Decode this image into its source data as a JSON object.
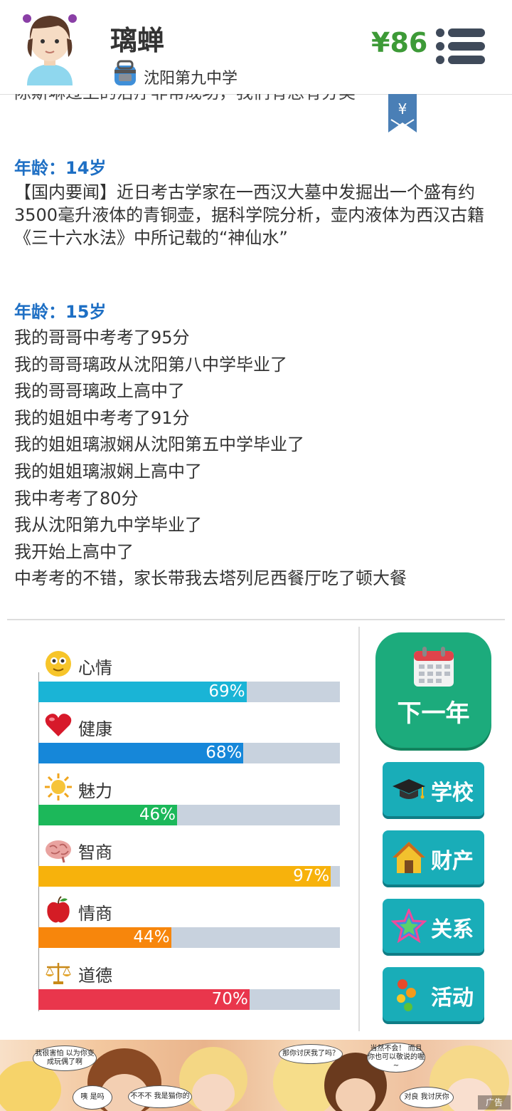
{
  "profile": {
    "name": "璃蝉",
    "school": "沈阳第九中学",
    "money": "¥86"
  },
  "log": {
    "cut_line": "陈斯琳过上的治疗非常成功，我们有总有分类",
    "bookmark_symbol": "¥",
    "entries": [
      {
        "age": "年龄：14岁",
        "lines": [
          "【国内要闻】近日考古学家在一西汉大墓中发掘出一个盛有约3500毫升液体的青铜壶，据科学院分析，壶内液体为西汉古籍《三十六水法》中所记载的“神仙水”"
        ]
      },
      {
        "age": "年龄：15岁",
        "lines": [
          "我的哥哥中考考了95分",
          "我的哥哥璃政从沈阳第八中学毕业了",
          "我的哥哥璃政上高中了",
          "我的姐姐中考考了91分",
          "我的姐姐璃淑娴从沈阳第五中学毕业了",
          "我的姐姐璃淑娴上高中了",
          "我中考考了80分",
          "我从沈阳第九中学毕业了",
          "我开始上高中了",
          "中考考的不错，家长带我去塔列尼西餐厅吃了顿大餐"
        ]
      }
    ]
  },
  "stats": [
    {
      "label": "心情",
      "value": 69,
      "pct": "69%",
      "color": "#1ab4d6",
      "icon": "smiley-icon"
    },
    {
      "label": "健康",
      "value": 68,
      "pct": "68%",
      "color": "#1687d9",
      "icon": "heart-icon"
    },
    {
      "label": "魅力",
      "value": 46,
      "pct": "46%",
      "color": "#1cb85a",
      "icon": "sun-icon"
    },
    {
      "label": "智商",
      "value": 97,
      "pct": "97%",
      "color": "#f7b20c",
      "icon": "brain-icon"
    },
    {
      "label": "情商",
      "value": 44,
      "pct": "44%",
      "color": "#f7860c",
      "icon": "apple-icon"
    },
    {
      "label": "道德",
      "value": 70,
      "pct": "70%",
      "color": "#e9364c",
      "icon": "scales-icon"
    }
  ],
  "actions": {
    "next_year": "下一年",
    "school": "学校",
    "property": "财产",
    "relations": "关系",
    "activities": "活动"
  },
  "ad": {
    "bubbles": [
      "我很害怕 以为你变成玩偶了啊",
      "咦 是吗",
      "不不不 我是猫你的",
      "那你讨厌我了吗？",
      "当然不会！ 而且你也可以敬说的喔~",
      "对良 我讨厌你"
    ],
    "badge": "广告"
  }
}
